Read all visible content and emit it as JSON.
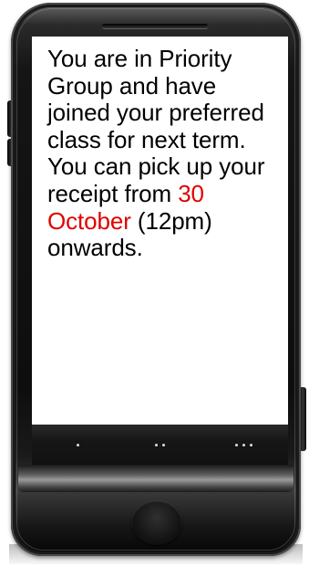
{
  "message": {
    "part1": "You are in Priority Group and have joined your preferred class for next term. You can pick up your receipt from ",
    "highlight": "30 October",
    "part2": " (12pm) onwards."
  },
  "colors": {
    "highlight": "#e00000",
    "text": "#000000",
    "screen_background": "#ffffff",
    "phone_body": "#151515"
  },
  "nav_buttons": [
    {
      "icon": "one-dot-icon"
    },
    {
      "icon": "two-dots-icon"
    },
    {
      "icon": "three-dots-icon"
    }
  ]
}
